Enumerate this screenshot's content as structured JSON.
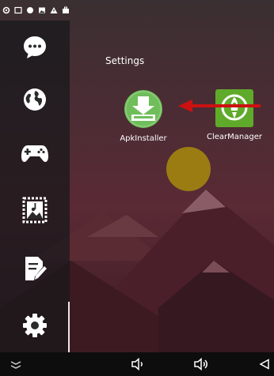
{
  "screen": {
    "section_title": "Settings",
    "apps": [
      {
        "label": "ApkInstaller",
        "icon": "apk-installer-icon"
      },
      {
        "label": "ClearManager",
        "icon": "rocket-icon"
      }
    ]
  },
  "sidebar": {
    "items": [
      {
        "icon": "chat-icon"
      },
      {
        "icon": "globe-icon"
      },
      {
        "icon": "gamepad-icon"
      },
      {
        "icon": "music-image-icon"
      },
      {
        "icon": "document-edit-icon"
      },
      {
        "icon": "gear-icon"
      }
    ]
  },
  "status_bar": {
    "icons": [
      "settings-icon",
      "screen-icon",
      "circle-icon",
      "gallery-icon",
      "warning-icon",
      "briefcase-icon"
    ]
  },
  "navbar": {
    "buttons": [
      "menu-icon",
      "volume-down-icon",
      "volume-up-icon",
      "back-icon"
    ]
  },
  "colors": {
    "accent_red": "#cc1111",
    "apk_installer_green": "#6fbe5b",
    "clear_manager_green": "#5faa2a"
  }
}
